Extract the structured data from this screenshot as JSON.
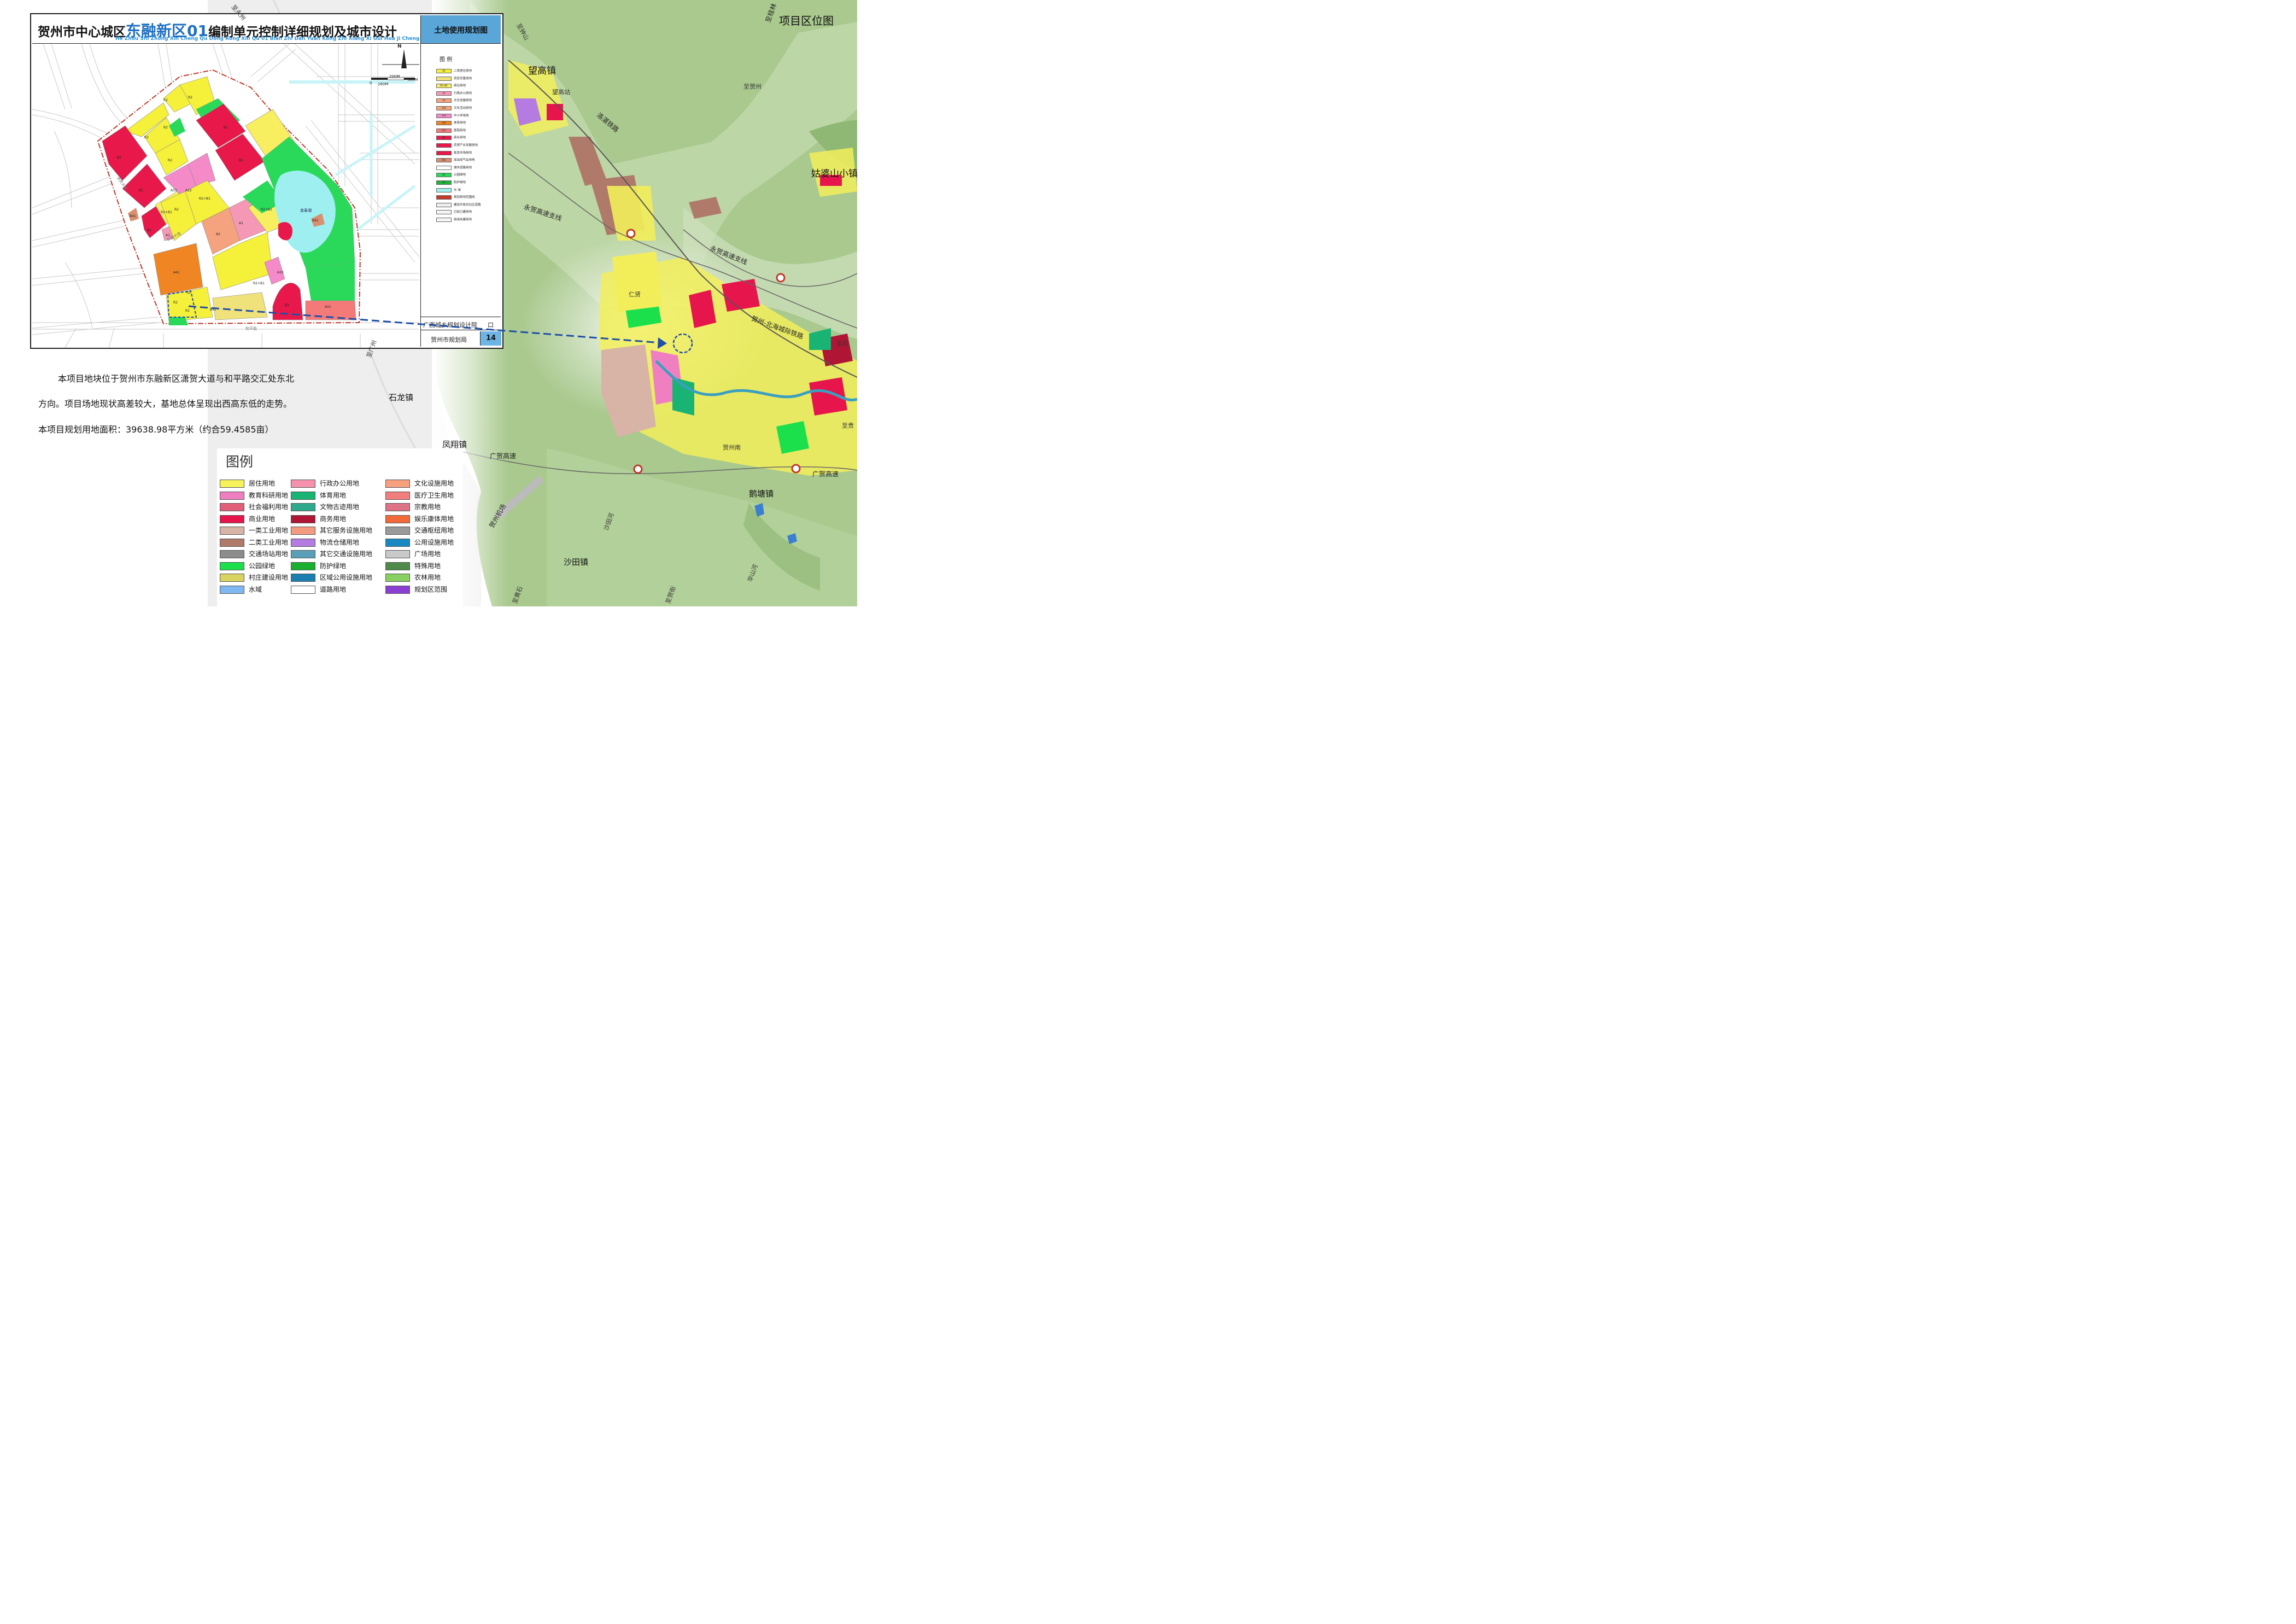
{
  "inset": {
    "title_prefix": "贺州市中心城区",
    "title_highlight": "东融新区01",
    "title_suffix": "编制单元控制详细规划及城市设计",
    "title_pinyin": "He Zhou Shi Zhong Xin Cheng Qu Dong Rong Xin Qu 01 Bian Zhi Dan Yuan Kong Zhi Xiang Xi Gui Hua Ji Cheng Shi She Ji",
    "panel_title": "土地使用规划图",
    "panel_legend_title": "图 例",
    "panel_legend": [
      {
        "code": "R2",
        "label": "二类居住用地",
        "color": "#f5f03a"
      },
      {
        "code": "",
        "label": "农民安置用地",
        "color": "#f0e27a"
      },
      {
        "code": "R2+B1",
        "label": "商住用地",
        "color": "#f7ee60"
      },
      {
        "code": "A1",
        "label": "行政办公用地",
        "color": "#f598b6"
      },
      {
        "code": "A2",
        "label": "文化设施用地",
        "color": "#f4a37e"
      },
      {
        "code": "A22",
        "label": "文化活动用地",
        "color": "#f2a67a"
      },
      {
        "code": "A33",
        "label": "中小学用地",
        "color": "#f58ac8"
      },
      {
        "code": "A41",
        "label": "体育用地",
        "color": "#f08524"
      },
      {
        "code": "A51",
        "label": "医院用地",
        "color": "#f47a7a"
      },
      {
        "code": "B1",
        "label": "商业用地",
        "color": "#e8184a"
      },
      {
        "code": "",
        "label": "农贸产业发展用地",
        "color": "#e8184a"
      },
      {
        "code": "",
        "label": "批发市场用地",
        "color": "#e8184a"
      },
      {
        "code": "B41",
        "label": "加油加气站用地",
        "color": "#d99070"
      },
      {
        "code": "",
        "label": "城市道路用地",
        "color": "#ffffff"
      },
      {
        "code": "G1",
        "label": "公园绿地",
        "color": "#2ad95a"
      },
      {
        "code": "G2",
        "label": "防护绿地",
        "color": "#21b23c"
      },
      {
        "code": "",
        "label": "水 域",
        "color": "#9ef0f0"
      },
      {
        "code": "",
        "label": "规划用地范围线",
        "color": "#c0392b"
      },
      {
        "code": "",
        "label": "建设开放式社区道路",
        "color": "#eeeeee"
      },
      {
        "code": "",
        "label": "已批已建用地",
        "color": "#f5f5f5"
      },
      {
        "code": "",
        "label": "拟用未建用地",
        "color": "#f5f5f5"
      }
    ],
    "institute": "广西城乡规划设计院",
    "institute_mark": "口",
    "agency": "贺州市规划局",
    "page_number": "14",
    "north": "N",
    "scale_labels": [
      "0",
      "160M",
      "200M",
      "300M"
    ],
    "parcel_labels": [
      "B1",
      "B1",
      "B1",
      "B1",
      "B1",
      "B1",
      "R2",
      "R2",
      "R2",
      "R2",
      "R2",
      "R2",
      "R2",
      "R2",
      "R2",
      "A1",
      "A1",
      "A2",
      "A41",
      "A33",
      "A33",
      "A22",
      "A51",
      "B41",
      "B41",
      "B41",
      "R2+B1",
      "R2+B1",
      "R2+B1",
      "R2+B1"
    ],
    "lake_label": "金泰湖",
    "road_labels": [
      "东融大道",
      "潇贺大道",
      "和平路"
    ]
  },
  "description": {
    "line1": "本项目地块位于贺州市东融新区潇贺大道与和平路交汇处东北",
    "line2": "方向。项目场地现状高差较大，基地总体呈现出西高东低的走势。",
    "line3": "本项目规划用地面积：39638.98平方米（约合59.4585亩）"
  },
  "legend": {
    "title": "图例",
    "items": [
      {
        "label": "居住用地",
        "color": "#f7f25a"
      },
      {
        "label": "行政办公用地",
        "color": "#f590ad"
      },
      {
        "label": "文化设施用地",
        "color": "#f6a07e"
      },
      {
        "label": "教育科研用地",
        "color": "#f07fc2"
      },
      {
        "label": "体育用地",
        "color": "#19b373"
      },
      {
        "label": "医疗卫生用地",
        "color": "#f27d7d"
      },
      {
        "label": "社会福利用地",
        "color": "#e0607a"
      },
      {
        "label": "文物古迹用地",
        "color": "#2fa88c"
      },
      {
        "label": "宗教用地",
        "color": "#dc7386"
      },
      {
        "label": "商业用地",
        "color": "#e6164c"
      },
      {
        "label": "商务用地",
        "color": "#b01535"
      },
      {
        "label": "娱乐康体用地",
        "color": "#f26a3a"
      },
      {
        "label": "一类工业用地",
        "color": "#d8b4a6"
      },
      {
        "label": "其它服务设施用地",
        "color": "#f49a7e"
      },
      {
        "label": "交通枢纽用地",
        "color": "#9a9a9a"
      },
      {
        "label": "二类工业用地",
        "color": "#b07a6a"
      },
      {
        "label": "物流仓储用地",
        "color": "#b47ce0"
      },
      {
        "label": "公用设施用地",
        "color": "#1a88c0"
      },
      {
        "label": "交通场站用地",
        "color": "#8c8c8c"
      },
      {
        "label": "其它交通设施用地",
        "color": "#5a9fb8"
      },
      {
        "label": "广场用地",
        "color": "#c9c9c9"
      },
      {
        "label": "公园绿地",
        "color": "#1be04c"
      },
      {
        "label": "防护绿地",
        "color": "#19b030"
      },
      {
        "label": "特殊用地",
        "color": "#4e8a4a"
      },
      {
        "label": "村庄建设用地",
        "color": "#d9d461"
      },
      {
        "label": "区域公用设施用地",
        "color": "#1a7fb0"
      },
      {
        "label": "农林用地",
        "color": "#8ad060"
      },
      {
        "label": "水域",
        "color": "#7fb8f0"
      },
      {
        "label": "道路用地",
        "color": "#ffffff"
      },
      {
        "label": "规划区范围",
        "color": "#8a3fd0"
      }
    ]
  },
  "location_map": {
    "label": "项目区位图",
    "places": [
      "望高镇",
      "姑婆山小镇",
      "石龙镇",
      "凤翔镇",
      "鹅塘镇",
      "沙田镇"
    ],
    "railways": [
      "洛湛铁路",
      "永贺高速支线",
      "永贺高速支线",
      "贺州-北海城际铁路",
      "广贺高速",
      "广贺高速",
      "贺州机场",
      "至桂林"
    ],
    "small_labels": [
      "至永州",
      "至钟山",
      "至贺州",
      "至广州",
      "沙田河",
      "华山河",
      "至黄石",
      "至贺街",
      "至凤",
      "望高站",
      "贺州南",
      "仁贤",
      "至贵"
    ]
  },
  "colors": {
    "terrain_green": "#a9c98e",
    "terrain_light": "#d9e6cc",
    "frame_blue": "#5aa6d8",
    "boundary_red": "#c0392b",
    "arrow_blue": "#1f4fa8"
  }
}
